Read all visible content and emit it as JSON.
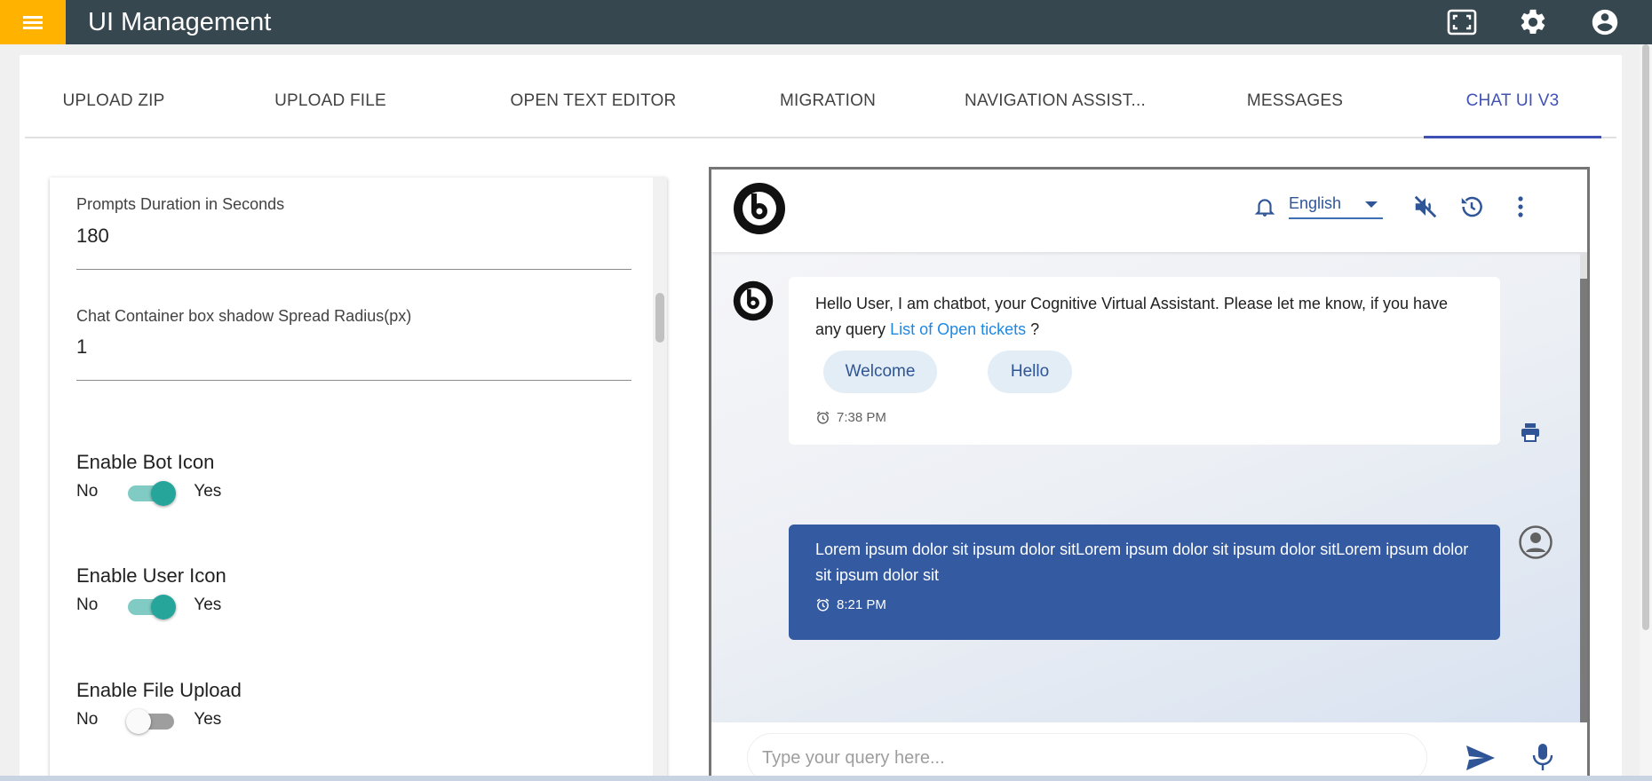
{
  "app": {
    "title": "UI Management"
  },
  "tabs": [
    {
      "label": "UPLOAD ZIP",
      "active": false
    },
    {
      "label": "UPLOAD FILE",
      "active": false
    },
    {
      "label": "OPEN TEXT EDITOR",
      "active": false
    },
    {
      "label": "MIGRATION",
      "active": false
    },
    {
      "label": "NAVIGATION ASSIST...",
      "active": false
    },
    {
      "label": "MESSAGES",
      "active": false
    },
    {
      "label": "CHAT UI V3",
      "active": true
    }
  ],
  "settings": {
    "prompts_duration": {
      "label": "Prompts Duration in Seconds",
      "value": "180"
    },
    "spread_radius": {
      "label": "Chat Container box shadow Spread Radius(px)",
      "value": "1"
    },
    "toggles": [
      {
        "title": "Enable Bot Icon",
        "no": "No",
        "yes": "Yes",
        "on": true
      },
      {
        "title": "Enable User Icon",
        "no": "No",
        "yes": "Yes",
        "on": true
      },
      {
        "title": "Enable File Upload",
        "no": "No",
        "yes": "Yes",
        "on": false
      }
    ]
  },
  "chat": {
    "language": "English",
    "bot_message": {
      "text": "Hello User, I am chatbot, your Cognitive Virtual Assistant. Please let me know, if you have any query",
      "link": "List of Open tickets",
      "suffix": " ?",
      "chips": [
        "Welcome",
        "Hello"
      ],
      "time": "7:38 PM"
    },
    "user_message": {
      "text": "Lorem ipsum dolor sit ipsum dolor sitLorem ipsum dolor sit ipsum dolor sitLorem ipsum dolor sit ipsum dolor sit",
      "time": "8:21 PM"
    },
    "input_placeholder": "Type your query here..."
  },
  "colors": {
    "topbar": "#37474f",
    "menu_accent": "#ffb300",
    "tab_active": "#3f51b5",
    "toggle_on": "#26a69a",
    "user_bubble": "#345aa1",
    "chip_bg": "#e3edf6",
    "link": "#1e88e5"
  },
  "icons": [
    "menu-icon",
    "fullscreen-icon",
    "settings-gear-icon",
    "account-circle-icon",
    "bot-logo-icon",
    "bell-icon",
    "mute-icon",
    "history-icon",
    "more-vert-icon",
    "alarm-clock-icon",
    "print-icon",
    "user-avatar-icon",
    "send-icon",
    "mic-icon"
  ]
}
